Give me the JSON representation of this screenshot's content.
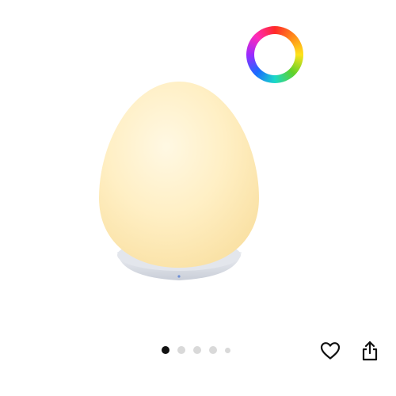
{
  "product": {
    "image_alt": "",
    "color_indicator_icon": "rgb-color-ring-icon",
    "lamp_light_color": "#fff1c2",
    "base_color": "#d8dce4"
  },
  "gallery": {
    "total_images": 5,
    "active_index": 0
  },
  "actions": {
    "wishlist_icon": "heart-outline-icon",
    "share_icon": "share-icon"
  }
}
